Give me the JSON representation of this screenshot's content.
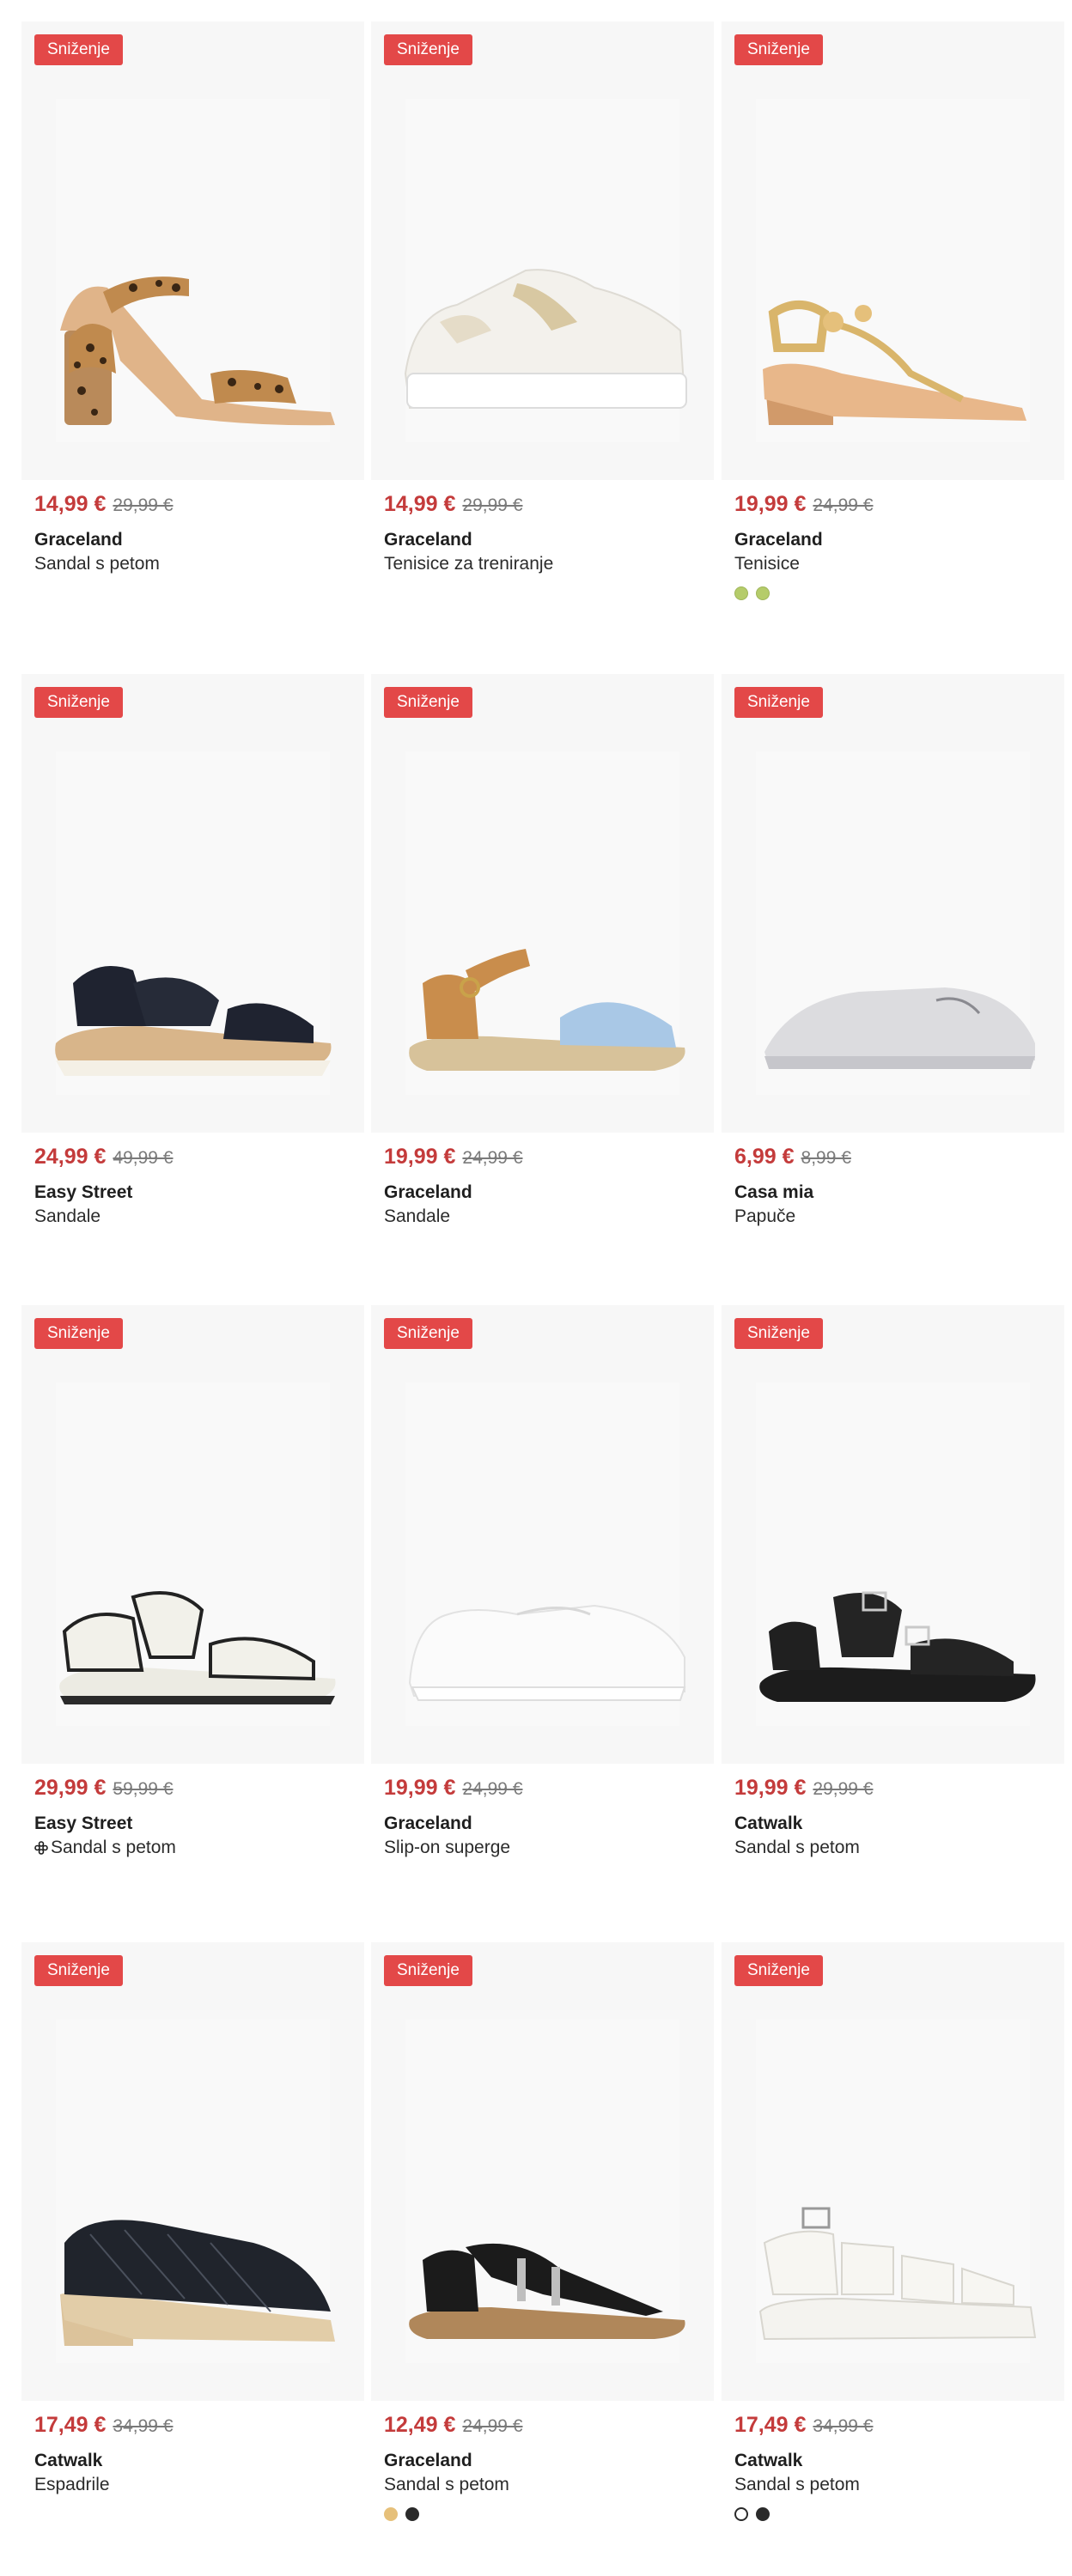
{
  "colors": {
    "sale_badge": "#e34848",
    "price": "#c43b3b"
  },
  "products": [
    {
      "badge": "Sniženje",
      "price": "14,99 €",
      "old_price": "29,99 €",
      "brand": "Graceland",
      "type": "Sandal s petom",
      "shoe": "leopard-heel-sandal-image",
      "swatches": []
    },
    {
      "badge": "Sniženje",
      "price": "14,99 €",
      "old_price": "29,99 €",
      "brand": "Graceland",
      "type": "Tenisice za treniranje",
      "shoe": "white-platform-sneaker-image",
      "swatches": []
    },
    {
      "badge": "Sniženje",
      "price": "19,99 €",
      "old_price": "24,99 €",
      "brand": "Graceland",
      "type": "Tenisice",
      "shoe": "gold-wedge-sandal-image",
      "swatches": [
        "#b5cc6a",
        "#b5cc6a"
      ]
    },
    {
      "badge": "Sniženje",
      "price": "24,99 €",
      "old_price": "49,99 €",
      "brand": "Easy Street",
      "type": "Sandale",
      "shoe": "black-velcro-sandal-image",
      "swatches": []
    },
    {
      "badge": "Sniženje",
      "price": "19,99 €",
      "old_price": "24,99 €",
      "brand": "Graceland",
      "type": "Sandale",
      "shoe": "espadrille-sandal-image",
      "swatches": []
    },
    {
      "badge": "Sniženje",
      "price": "6,99 €",
      "old_price": "8,99 €",
      "brand": "Casa mia",
      "type": "Papuče",
      "shoe": "grey-slipper-image",
      "swatches": []
    },
    {
      "badge": "Sniženje",
      "price": "29,99 €",
      "old_price": "59,99 €",
      "brand": "Easy Street",
      "type": "Sandal s petom",
      "shoe": "white-sport-sandal-image",
      "flower": "flower-icon",
      "swatches": []
    },
    {
      "badge": "Sniženje",
      "price": "19,99 €",
      "old_price": "24,99 €",
      "brand": "Graceland",
      "type": "Slip-on superge",
      "shoe": "white-knit-sneaker-image",
      "swatches": []
    },
    {
      "badge": "Sniženje",
      "price": "19,99 €",
      "old_price": "29,99 €",
      "brand": "Catwalk",
      "type": "Sandal s petom",
      "shoe": "black-buckle-sandal-image",
      "swatches": []
    },
    {
      "badge": "Sniženje",
      "price": "17,49 €",
      "old_price": "34,99 €",
      "brand": "Catwalk",
      "type": "Espadrile",
      "shoe": "black-mesh-espadrille-image",
      "swatches": []
    },
    {
      "badge": "Sniženje",
      "price": "12,49 €",
      "old_price": "24,99 €",
      "brand": "Graceland",
      "type": "Sandal s petom",
      "shoe": "black-strappy-sandal-image",
      "swatches": [
        "#e6c07a",
        "#2a2a2a"
      ]
    },
    {
      "badge": "Sniženje",
      "price": "17,49 €",
      "old_price": "34,99 €",
      "brand": "Catwalk",
      "type": "Sandal s petom",
      "shoe": "white-chunky-sandal-image",
      "swatches": [
        "#ffffff",
        "#2a2a2a"
      ]
    }
  ]
}
